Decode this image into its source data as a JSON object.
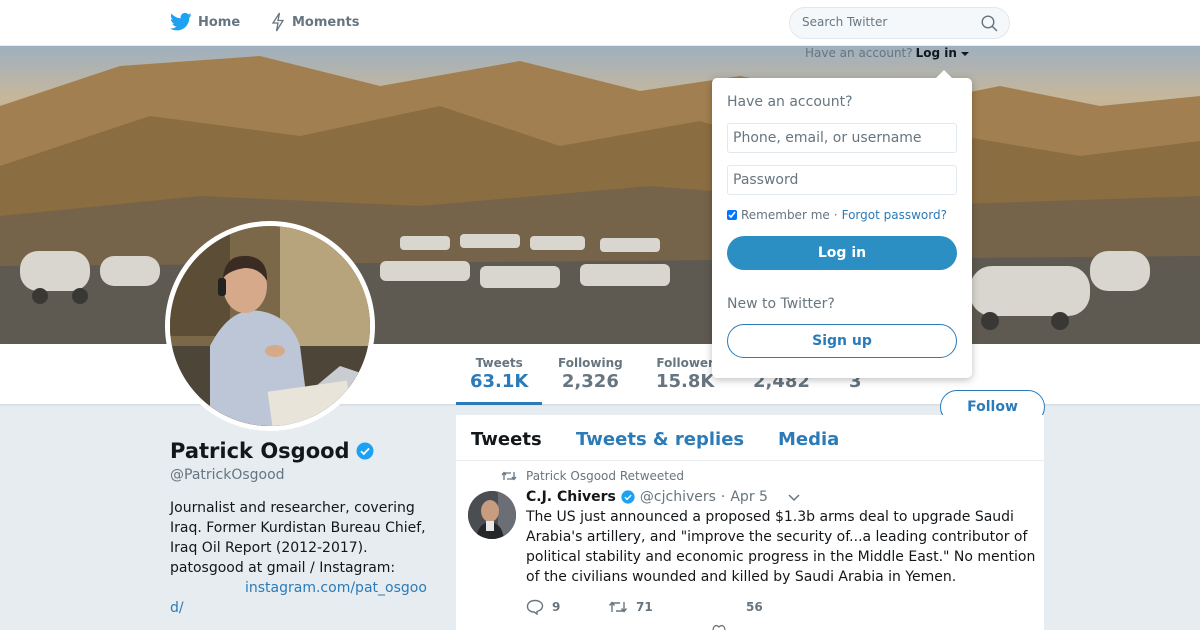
{
  "nav": {
    "home": "Home",
    "moments": "Moments",
    "search_placeholder": "Search Twitter",
    "have_account": "Have an account?",
    "login_link": "Log in"
  },
  "login_popup": {
    "title": "Have an account?",
    "username_placeholder": "Phone, email, or username",
    "password_placeholder": "Password",
    "remember": "Remember me",
    "separator": "·",
    "forgot": "Forgot password?",
    "login_button": "Log in",
    "new_to": "New to Twitter?",
    "signup_button": "Sign up"
  },
  "stats": [
    {
      "label": "Tweets",
      "value": "63.1K",
      "active": true
    },
    {
      "label": "Following",
      "value": "2,326"
    },
    {
      "label": "Follower",
      "value": "15.8K"
    },
    {
      "label": "",
      "value": "2,482"
    },
    {
      "label": "",
      "value": "3"
    }
  ],
  "follow_button": "Follow",
  "profile": {
    "name": "Patrick Osgood",
    "handle": "@PatrickOsgood",
    "bio": "Journalist and researcher, covering Iraq. Former Kurdistan Bureau Chief, Iraq Oil Report (2012-2017). patosgood at gmail / Instagram:",
    "link_part1": "instagram.com/pat_osgoo",
    "link_part2": "d/"
  },
  "tabs": [
    "Tweets",
    "Tweets & replies",
    "Media"
  ],
  "tweet": {
    "retweeted_by": "Patrick Osgood Retweeted",
    "author": "C.J. Chivers",
    "handle": "@cjchivers",
    "separator": "·",
    "date": "Apr 5",
    "text": "The US just announced a proposed $1.3b arms deal to upgrade Saudi Arabia's artillery, and \"improve the security of...a leading contributor of political stability and economic progress in the Middle East.\" No mention of the civilians wounded and killed by Saudi Arabia in Yemen.",
    "replies": "9",
    "retweets": "71",
    "likes": "56"
  },
  "colors": {
    "accent": "#2b7bb9",
    "login_button": "#2b8fc4",
    "verified": "#1da1f2",
    "background": "#e6ecf0"
  }
}
